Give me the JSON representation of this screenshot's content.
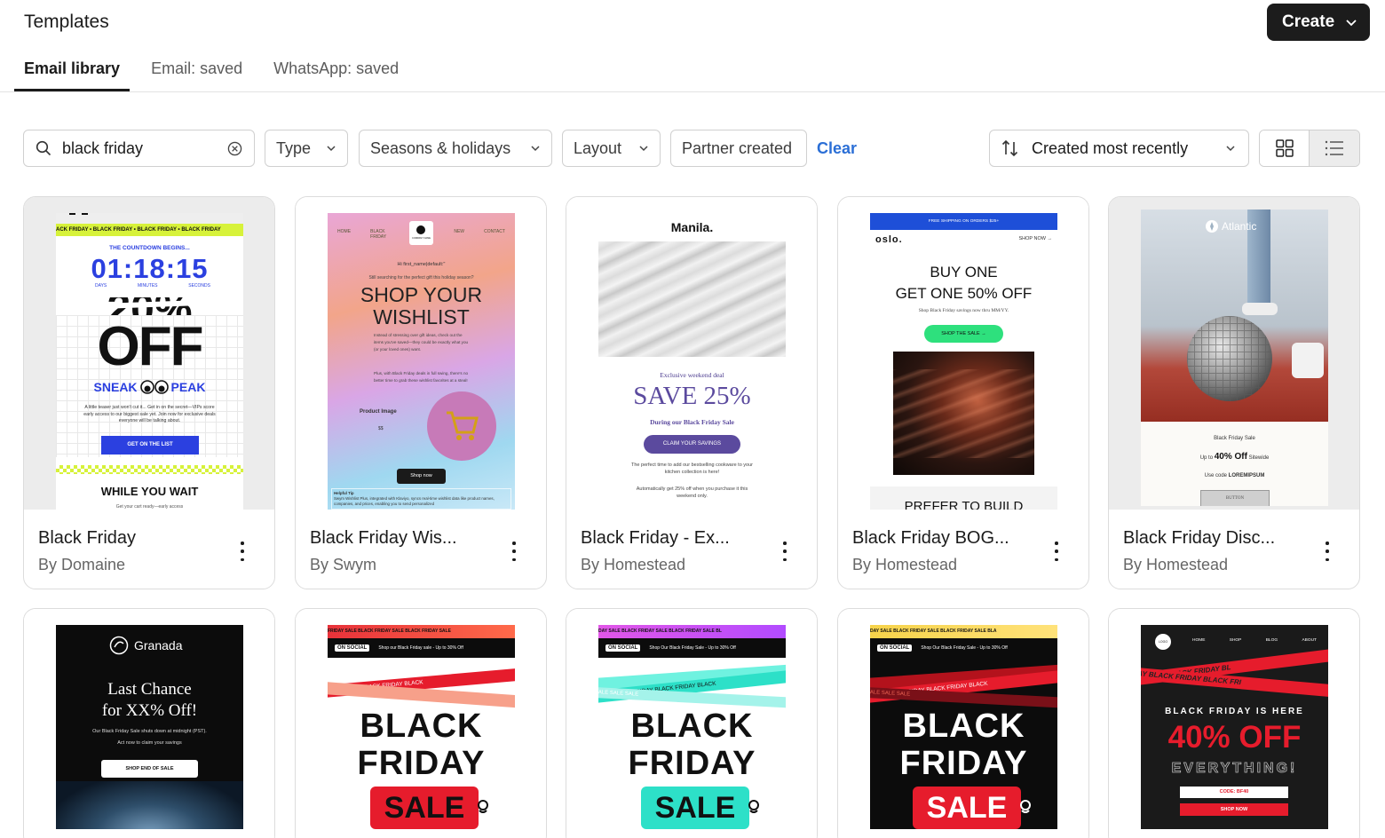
{
  "header": {
    "title": "Templates",
    "create_label": "Create"
  },
  "tabs": [
    {
      "label": "Email library",
      "active": true
    },
    {
      "label": "Email: saved",
      "active": false
    },
    {
      "label": "WhatsApp: saved",
      "active": false
    }
  ],
  "filters": {
    "search_value": "black friday",
    "type": "Type",
    "seasons": "Seasons & holidays",
    "layout": "Layout",
    "partner": "Partner created",
    "clear": "Clear",
    "sort": "Created most recently"
  },
  "cards": [
    {
      "title": "Black Friday",
      "author": "By Domaine",
      "preview": {
        "ticker": "ACK FRIDAY • BLACK FRIDAY • BLACK FRIDAY • BLACK FRIDAY",
        "countdown_title": "THE COUNTDOWN BEGINS...",
        "time": "01:18:15",
        "units": [
          "DAYS",
          "MINUTES",
          "SECONDS"
        ],
        "partial": "20%",
        "off": "OFF",
        "sneak": "SNEAK",
        "peak": "PEAK",
        "body": "A little teaser just won't cut it... Get in on the secret—VIPs score early access to our biggest sale yet. Join now for exclusive deals everyone will be talking about.",
        "cta": "GET ON THE LIST",
        "footer": "WHILE YOU WAIT",
        "footer_sub": "Get your cart ready—early access"
      }
    },
    {
      "title": "Black Friday Wis...",
      "author": "By Swym",
      "preview": {
        "nav": [
          "HOME",
          "BLACK FRIDAY",
          "NEW",
          "CONTACT"
        ],
        "logo": "COMPANY NAME",
        "greeting": "Hi first_name|default:''",
        "intro": "Still searching for the perfect gift this holiday season?",
        "headline1": "SHOP YOUR",
        "headline2": "WISHLIST",
        "body1": "Instead of stressing over gift ideas, check out the items you've saved—they could be exactly what you (or your loved ones) want.",
        "body2": "Plus, with Black Friday deals in full swing, there's no better time to grab these wishlist favorites at a steal!",
        "product_label": "Product Image",
        "price": "$$",
        "cta": "Shop now",
        "tip_label": "Helpful Tip",
        "tip": "Swym Wishlist Plus, integrated with Klaviyo, syncs real-time wishlist data like product names, companies, and prices, enabling you to send personalized"
      }
    },
    {
      "title": "Black Friday - Ex...",
      "author": "By Homestead",
      "preview": {
        "brand": "Manila.",
        "eyebrow": "Exclusive weekend deal",
        "headline": "SAVE 25%",
        "sub": "During our Black Friday Sale",
        "cta": "CLAIM YOUR SAVINGS",
        "body1": "The perfect time to add our bestselling cookware to your kitchen collection is here!",
        "body2": "Automatically get 25% off when you purchase it this weekend only."
      }
    },
    {
      "title": "Black Friday BOG...",
      "author": "By Homestead",
      "preview": {
        "banner": "FREE SHIPPING ON ORDERS $25+",
        "brand": "oslo.",
        "shop": "SHOP NOW →",
        "headline1": "BUY ONE",
        "headline2": "GET ONE 50% OFF",
        "sub": "Shop Black Friday savings now thru MM/YY.",
        "cta": "SHOP THE SALE →",
        "footer": "PREFER TO BUILD"
      }
    },
    {
      "title": "Black Friday Disc...",
      "author": "By Homestead",
      "preview": {
        "brand": "Atlantic",
        "label": "Black Friday Sale",
        "upto": "Up to",
        "pct": "40% Off",
        "sitewide": "Sitewide",
        "code_text": "Use code",
        "code": "LOREMIPSUM",
        "button": "BUTTON"
      }
    },
    {
      "preview": {
        "brand": "Granada",
        "headline1": "Last Chance",
        "headline2": "for XX% Off!",
        "body1": "Our Black Friday Sale shuts down at midnight (PST).",
        "body2": "Act now to claim your savings",
        "cta": "SHOP END OF SALE"
      }
    },
    {
      "preview": {
        "ticker": "FRIDAY SALE    BLACK FRIDAY SALE    BLACK FRIDAY SALE",
        "social": "ON SOCIAL",
        "promo": "Shop our Black Friday sale - Up to 30% Off",
        "tape1": "BLACK FRIDAY    BLACK FRIDAY    BLACK",
        "line1": "BLACK",
        "line2": "FRIDAY",
        "sale": "SALE"
      }
    },
    {
      "preview": {
        "ticker": "DAY SALE    BLACK FRIDAY SALE    BLACK FRIDAY SALE    BL",
        "social": "ON SOCIAL",
        "promo": "Shop Our Black Friday Sale - Up to 30% Off",
        "tape1": "FRIDAY    BLACK FRIDAY    BLACK FRIDAY    BLACK",
        "tape2": "E    SALE    SALE    SALE",
        "line1": "BLACK",
        "line2": "FRIDAY",
        "sale": "SALE"
      }
    },
    {
      "preview": {
        "ticker": "DAY SALE    BLACK FRIDAY SALE    BLACK FRIDAY SALE    BLA",
        "social": "ON SOCIAL",
        "promo": "Shop Our Black Friday Sale - Up to 30% Off",
        "tape1": "FRIDAY    BLACK FRIDAY    BLACK FRIDAY    BLACK",
        "tape2": "E    SALE    SALE    SALE",
        "line1": "BLACK",
        "line2": "FRIDAY",
        "sale": "SALE"
      }
    },
    {
      "preview": {
        "logo": "LOGO",
        "nav": [
          "HOME",
          "SHOP",
          "BLOG",
          "ABOUT"
        ],
        "tape1": "K FRIDAY    BLACK FRIDAY    BL",
        "tape2": "DAY    BLACK FRIDAY    BLACK FRI",
        "headline": "BLACK FRIDAY IS HERE",
        "pct": "40% OFF",
        "everything": "EVERYTHING!",
        "code": "CODE: BF40",
        "cta": "SHOP NOW"
      }
    }
  ],
  "colors": {
    "accent_link": "#2b6fd6",
    "primary_button": "#1c1c1c"
  }
}
